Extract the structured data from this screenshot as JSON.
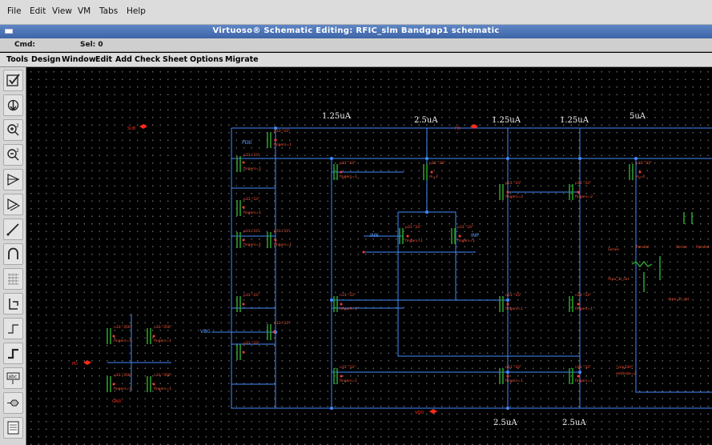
{
  "vm_menu": [
    "File",
    "Edit",
    "View",
    "VM",
    "Tabs",
    "Help"
  ],
  "window": {
    "title": "Virtuoso® Schematic Editing: RFIC_slm Bandgap1 schematic"
  },
  "status": {
    "cmd_label": "Cmd:",
    "sel_label": "Sel: 0"
  },
  "app_menu": [
    "Tools",
    "Design",
    "Window",
    "Edit",
    "Add",
    "Check",
    "Sheet",
    "Options",
    "Migrate"
  ],
  "toolbar_icons": [
    "check-and-save-icon",
    "fit-icon",
    "zoom-in-icon",
    "zoom-out-icon",
    "stretch-icon",
    "copy-icon",
    "wire-icon",
    "symbol-icon",
    "instance-icon",
    "pin-icon",
    "wire-narrow-icon",
    "wire-wide-icon",
    "label-icon",
    "net-icon",
    "property-icon",
    "undo-icon"
  ],
  "schematic": {
    "current_labels": [
      {
        "text": "1.25uA"
      },
      {
        "text": "2.5uA"
      },
      {
        "text": "1.25uA"
      },
      {
        "text": "1.25uA"
      },
      {
        "text": "5uA"
      },
      {
        "text": "2.5uA"
      },
      {
        "text": "2.5uA"
      }
    ],
    "pins": [
      {
        "name": "SUB",
        "color": "#ff2a1a"
      },
      {
        "name": "PD",
        "color": "#ff2a1a"
      },
      {
        "name": "VDD",
        "color": "#ff2a1a"
      },
      {
        "name": "INN",
        "color": "#5aa0ff"
      },
      {
        "name": "INP",
        "color": "#5aa0ff"
      },
      {
        "name": "VBG",
        "color": "#5aa0ff"
      },
      {
        "name": "PDb",
        "color": "#5aa0ff"
      },
      {
        "name": "PD",
        "color": "#ff2a1a"
      },
      {
        "name": "GND",
        "color": "#ff2a1a"
      }
    ],
    "colors": {
      "wire": "#3f8cff",
      "device": "#2a9a2a",
      "instance_text": "#ff5a3c",
      "background": "#000000"
    }
  }
}
